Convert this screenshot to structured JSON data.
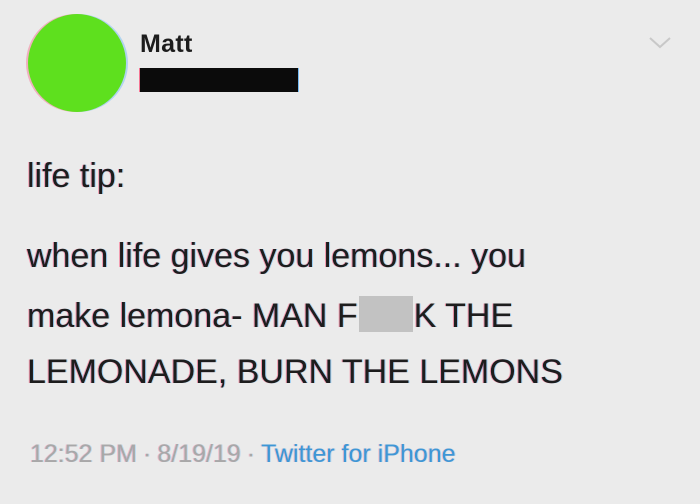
{
  "tweet": {
    "author": {
      "display_name": "Matt",
      "avatar_color": "#5ee01e"
    },
    "text": {
      "tip": "life tip:",
      "line1": "when life gives you lemons... you",
      "line2_before": "make lemona- MAN F",
      "line2_after": "K THE",
      "line3": "LEMONADE, BURN THE LEMONS"
    },
    "meta": {
      "time": "12:52 PM",
      "separator": "·",
      "date": "8/19/19",
      "source": "Twitter for iPhone"
    },
    "colors": {
      "background": "#ebebeb",
      "link": "#3d97d6",
      "muted": "#a8a8a8"
    },
    "icons": {
      "menu": "chevron-down-icon"
    }
  }
}
